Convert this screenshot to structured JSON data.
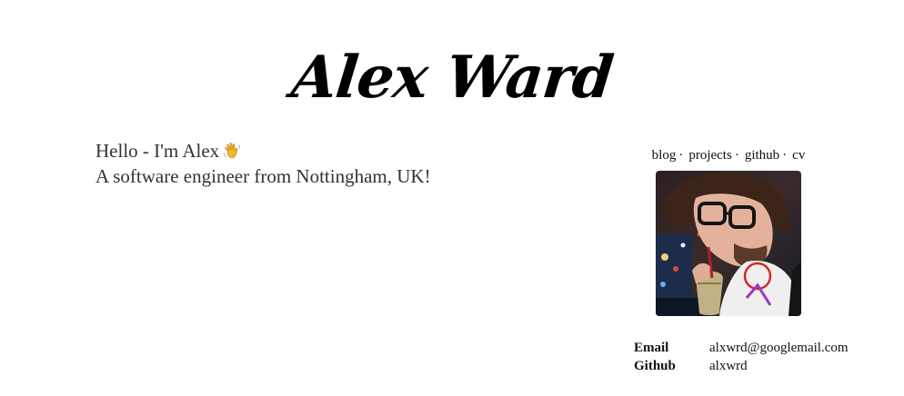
{
  "header": {
    "title": "Alex Ward"
  },
  "intro": {
    "greeting": "Hello - I'm Alex",
    "tagline": "A software engineer from Nottingham, UK!",
    "greeting_icon": "waving-hand-icon"
  },
  "nav": {
    "items": [
      {
        "label": "blog",
        "separator": "·"
      },
      {
        "label": "projects",
        "separator": "·"
      },
      {
        "label": "github",
        "separator": "·"
      },
      {
        "label": "cv"
      }
    ]
  },
  "avatar": {
    "subject": "profile-photo"
  },
  "contact": {
    "rows": [
      {
        "key": "Email",
        "value": "alxwrd@googlemail.com"
      },
      {
        "key": "Github",
        "value": "alxwrd"
      }
    ]
  },
  "colors": {
    "title": "#000000",
    "text": "#333333",
    "links": "#111111",
    "wave": "#f2b632"
  }
}
